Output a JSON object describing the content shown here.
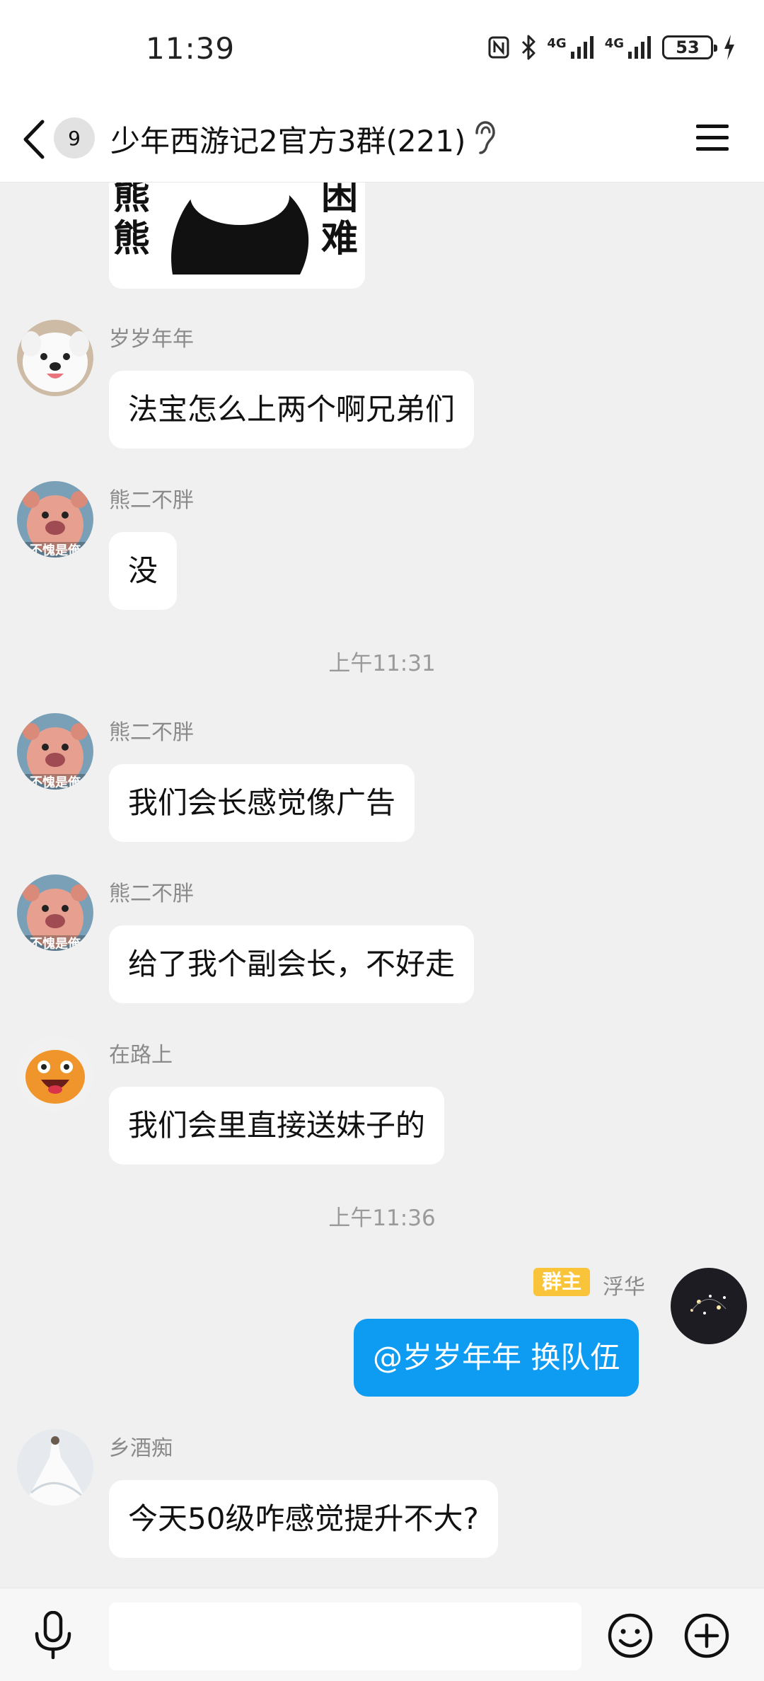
{
  "status_bar": {
    "time": "11:39",
    "network_1": "4G",
    "network_2": "4G",
    "battery": "53"
  },
  "header": {
    "unread_count": "9",
    "title": "少年西游记2官方3群(221)"
  },
  "sticker": {
    "left_chars": [
      "熊",
      "熊"
    ],
    "right_chars": [
      "困",
      "难"
    ]
  },
  "messages": [
    {
      "sender": "岁岁年年",
      "text": "法宝怎么上两个啊兄弟们"
    },
    {
      "sender": "熊二不胖",
      "text": "没"
    },
    {
      "sender": "熊二不胖",
      "text": "我们会长感觉像广告"
    },
    {
      "sender": "熊二不胖",
      "text": "给了我个副会长，不好走"
    },
    {
      "sender": "在路上",
      "text": "我们会里直接送妹子的"
    },
    {
      "sender": "浮华",
      "badge": "群主",
      "text": "@岁岁年年 换队伍"
    },
    {
      "sender": "乡酒痴",
      "text": "今天50级咋感觉提升不大?"
    }
  ],
  "time_dividers": [
    "上午11:31",
    "上午11:36"
  ],
  "avatar_captions": {
    "bear": "不愧是俺"
  },
  "input": {
    "placeholder": ""
  },
  "colors": {
    "accent": "#0e9bf2",
    "owner_badge": "#f9c43a",
    "background": "#f0f0f0"
  }
}
